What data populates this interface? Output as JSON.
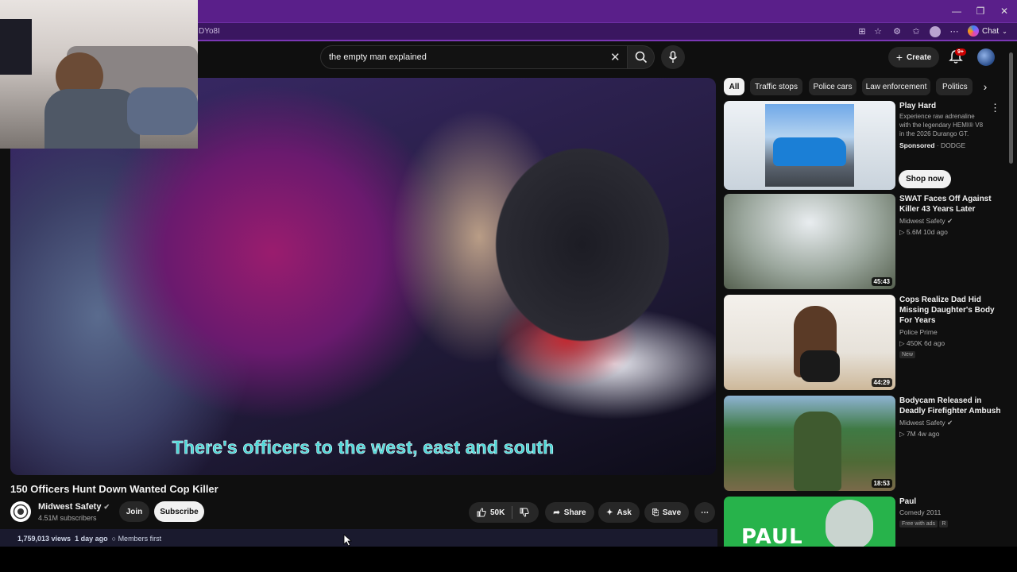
{
  "browser": {
    "url_fragment": "DYo8I",
    "chat_label": "Chat",
    "window_controls": [
      "minimize-icon",
      "restore-icon",
      "close-icon"
    ]
  },
  "youtube": {
    "search": {
      "value": "the empty man explained"
    },
    "header": {
      "create_label": "Create",
      "notification_count": "9+"
    },
    "video": {
      "subtitle": "There's officers to the west, east and south",
      "title": "150 Officers Hunt Down Wanted Cop Killer",
      "channel": {
        "name": "Midwest Safety",
        "subscribers": "4.51M subscribers"
      },
      "join_label": "Join",
      "subscribe_label": "Subscribe",
      "likes": "50K",
      "share_label": "Share",
      "ask_label": "Ask",
      "save_label": "Save",
      "meta": {
        "views": "1,759,013 views",
        "age": "1 day ago",
        "members": "Members first"
      }
    },
    "chips": [
      "All",
      "Traffic stops",
      "Police cars",
      "Law enforcement",
      "Politics"
    ],
    "recommendations": [
      {
        "title": "Play Hard",
        "desc": "Experience raw adrenaline with the legendary HEMI® V8 in the 2026 Durango GT.",
        "sponsored": "Sponsored",
        "advertiser": "DODGE",
        "cta": "Shop now"
      },
      {
        "title": "SWAT Faces Off Against Killer 43 Years Later",
        "channel": "Midwest Safety",
        "stats": "5.6M  10d ago",
        "duration": "45:43"
      },
      {
        "title": "Cops Realize Dad Hid Missing Daughter's Body For Years",
        "channel": "Police Prime",
        "stats": "450K  6d ago",
        "badge": "New",
        "duration": "44:29"
      },
      {
        "title": "Bodycam Released in Deadly Firefighter Ambush",
        "channel": "Midwest Safety",
        "stats": "7M  4w ago",
        "duration": "18:53"
      },
      {
        "title": "Paul",
        "channel": "Comedy 2011",
        "badge": "Free with ads",
        "rating": "R",
        "thumb_text": "PAUL"
      }
    ]
  }
}
